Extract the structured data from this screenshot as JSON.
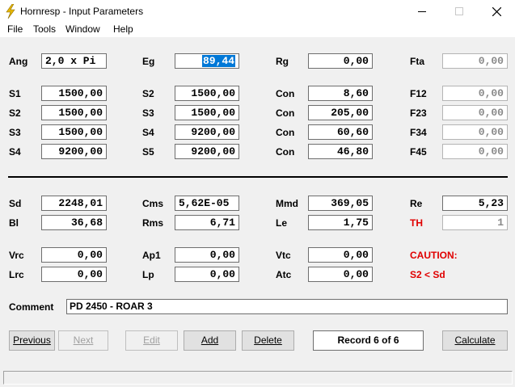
{
  "window": {
    "title": "Hornresp - Input Parameters",
    "icon": "lightning-icon",
    "controls": {
      "minimize": "minimize-icon",
      "maximize": "maximize-icon",
      "close": "close-icon"
    }
  },
  "menu": [
    "File",
    "Tools",
    "Window",
    "Help"
  ],
  "horn": {
    "ang": {
      "label": "Ang",
      "value": "2,0 x Pi"
    },
    "eg": {
      "label": "Eg",
      "value": "89,44"
    },
    "rg": {
      "label": "Rg",
      "value": "0,00"
    },
    "fta": {
      "label": "Fta",
      "value": "0,00"
    },
    "row1": {
      "a_label": "S1",
      "a": "1500,00",
      "b_label": "S2",
      "b": "1500,00",
      "c_label": "Con",
      "c": "8,60",
      "d_label": "F12",
      "d": "0,00"
    },
    "row2": {
      "a_label": "S2",
      "a": "1500,00",
      "b_label": "S3",
      "b": "1500,00",
      "c_label": "Con",
      "c": "205,00",
      "d_label": "F23",
      "d": "0,00"
    },
    "row3": {
      "a_label": "S3",
      "a": "1500,00",
      "b_label": "S4",
      "b": "9200,00",
      "c_label": "Con",
      "c": "60,60",
      "d_label": "F34",
      "d": "0,00"
    },
    "row4": {
      "a_label": "S4",
      "a": "9200,00",
      "b_label": "S5",
      "b": "9200,00",
      "c_label": "Con",
      "c": "46,80",
      "d_label": "F45",
      "d": "0,00"
    }
  },
  "driver": {
    "sd": {
      "label": "Sd",
      "value": "2248,01"
    },
    "cms": {
      "label": "Cms",
      "value": "5,62E-05"
    },
    "mmd": {
      "label": "Mmd",
      "value": "369,05"
    },
    "re": {
      "label": "Re",
      "value": "5,23"
    },
    "bl": {
      "label": "Bl",
      "value": "36,68"
    },
    "rms": {
      "label": "Rms",
      "value": "6,71"
    },
    "le": {
      "label": "Le",
      "value": "1,75"
    },
    "th": {
      "label": "TH",
      "value": "1"
    }
  },
  "chambers": {
    "vrc": {
      "label": "Vrc",
      "value": "0,00"
    },
    "ap1": {
      "label": "Ap1",
      "value": "0,00"
    },
    "vtc": {
      "label": "Vtc",
      "value": "0,00"
    },
    "lrc": {
      "label": "Lrc",
      "value": "0,00"
    },
    "lp": {
      "label": "Lp",
      "value": "0,00"
    },
    "atc": {
      "label": "Atc",
      "value": "0,00"
    },
    "caution": "CAUTION:",
    "caution_msg": "S2 < Sd"
  },
  "comment": {
    "label": "Comment",
    "value": "PD 2450 - ROAR 3"
  },
  "buttons": {
    "previous": "Previous",
    "next": "Next",
    "edit": "Edit",
    "add": "Add",
    "delete": "Delete",
    "record": "Record 6 of 6",
    "calculate": "Calculate"
  },
  "colors": {
    "selection": "#0078d7",
    "caution": "#e00000",
    "icon": "#e8b800"
  }
}
